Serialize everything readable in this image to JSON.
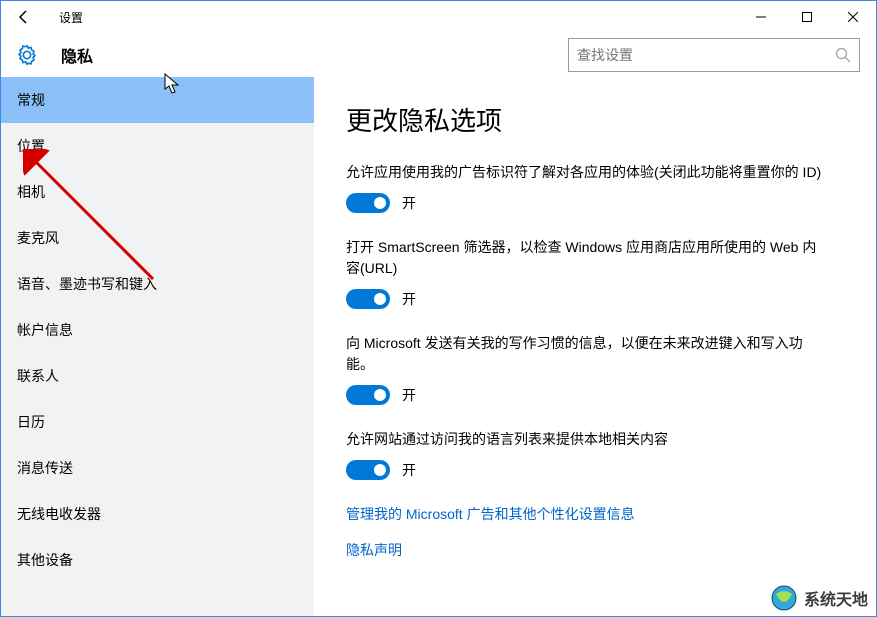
{
  "window": {
    "title": "设置"
  },
  "header": {
    "title": "隐私",
    "search_placeholder": "查找设置"
  },
  "sidebar": {
    "items": [
      {
        "label": "常规"
      },
      {
        "label": "位置"
      },
      {
        "label": "相机"
      },
      {
        "label": "麦克风"
      },
      {
        "label": "语音、墨迹书写和键入"
      },
      {
        "label": "帐户信息"
      },
      {
        "label": "联系人"
      },
      {
        "label": "日历"
      },
      {
        "label": "消息传送"
      },
      {
        "label": "无线电收发器"
      },
      {
        "label": "其他设备"
      }
    ]
  },
  "content": {
    "heading": "更改隐私选项",
    "settings": [
      {
        "desc": "允许应用使用我的广告标识符了解对各应用的体验(关闭此功能将重置你的 ID)",
        "state": "开"
      },
      {
        "desc": "打开 SmartScreen 筛选器，以检查 Windows 应用商店应用所使用的 Web 内容(URL)",
        "state": "开"
      },
      {
        "desc": "向 Microsoft 发送有关我的写作习惯的信息，以便在未来改进键入和写入功能。",
        "state": "开"
      },
      {
        "desc": "允许网站通过访问我的语言列表来提供本地相关内容",
        "state": "开"
      }
    ],
    "links": [
      {
        "text": "管理我的 Microsoft 广告和其他个性化设置信息"
      },
      {
        "text": "隐私声明"
      }
    ]
  },
  "watermark": {
    "text": "系统天地"
  }
}
